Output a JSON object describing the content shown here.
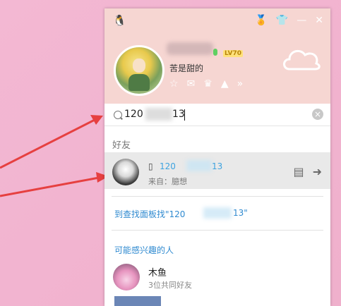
{
  "header": {
    "nickname": "苦是甜的",
    "level_badge": "LV70",
    "top_icons": [
      "penguin-icon",
      "medal-icon",
      "shirt-icon",
      "minimize-icon",
      "close-icon"
    ],
    "toolbar_icons": [
      "star-icon",
      "mail-icon",
      "crown-icon",
      "tent-icon",
      "more-icon"
    ]
  },
  "search": {
    "value": "120",
    "value_suffix": "13",
    "clear_label": "×"
  },
  "friends": {
    "section_title": "好友",
    "items": [
      {
        "name_prefix": "120",
        "name_suffix": "13",
        "source": "来自：臆想"
      }
    ]
  },
  "links": {
    "find_more": "到查找面板找\"120",
    "find_more_suffix": "13\""
  },
  "recommend": {
    "section_title": "可能感兴趣的人",
    "items": [
      {
        "name": "木鱼",
        "mutual": "3位共同好友"
      }
    ]
  },
  "colors": {
    "header_bg": "#f6d6d2",
    "accent": "#2f8ad0",
    "arrow": "#e64040"
  }
}
